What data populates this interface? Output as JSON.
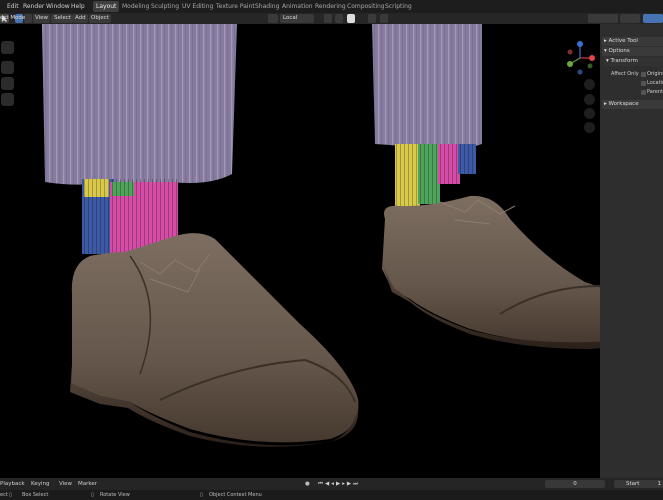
{
  "topbar": {
    "menus": [
      "Edit",
      "Render",
      "Window",
      "Help"
    ],
    "workspaces": [
      "Layout",
      "Modeling",
      "Sculpting",
      "UV Editing",
      "Texture Paint",
      "Shading",
      "Animation",
      "Rendering",
      "Compositing",
      "Scripting"
    ],
    "active_workspace": "Layout"
  },
  "header": {
    "mode": "ect Mode",
    "menus": [
      "View",
      "Select",
      "Add",
      "Object"
    ],
    "orientation": "Local"
  },
  "sidebar": {
    "active_tool": "Active Tool",
    "options": "Options",
    "transform": "Transform",
    "affect_only": "Affect Only",
    "checkboxes": [
      "Origins",
      "Locations",
      "Parents"
    ],
    "workspace": "Workspace"
  },
  "timeline": {
    "menus": [
      "Playback",
      "Keying",
      "View",
      "Marker"
    ],
    "current_frame": "0",
    "start_label": "Start",
    "start_value": "1"
  },
  "status": {
    "items": [
      "ect",
      "Box Select",
      "Rotate View",
      "Object Context Menu"
    ]
  },
  "colors": {
    "accent": "#4772b3",
    "trousers": "#8a7ea2",
    "shoe": "#6a5c50",
    "sock_pink": "#d54ca6",
    "sock_yellow": "#d9c94a",
    "sock_green": "#4fa35a",
    "sock_blue": "#3e5aa6"
  }
}
